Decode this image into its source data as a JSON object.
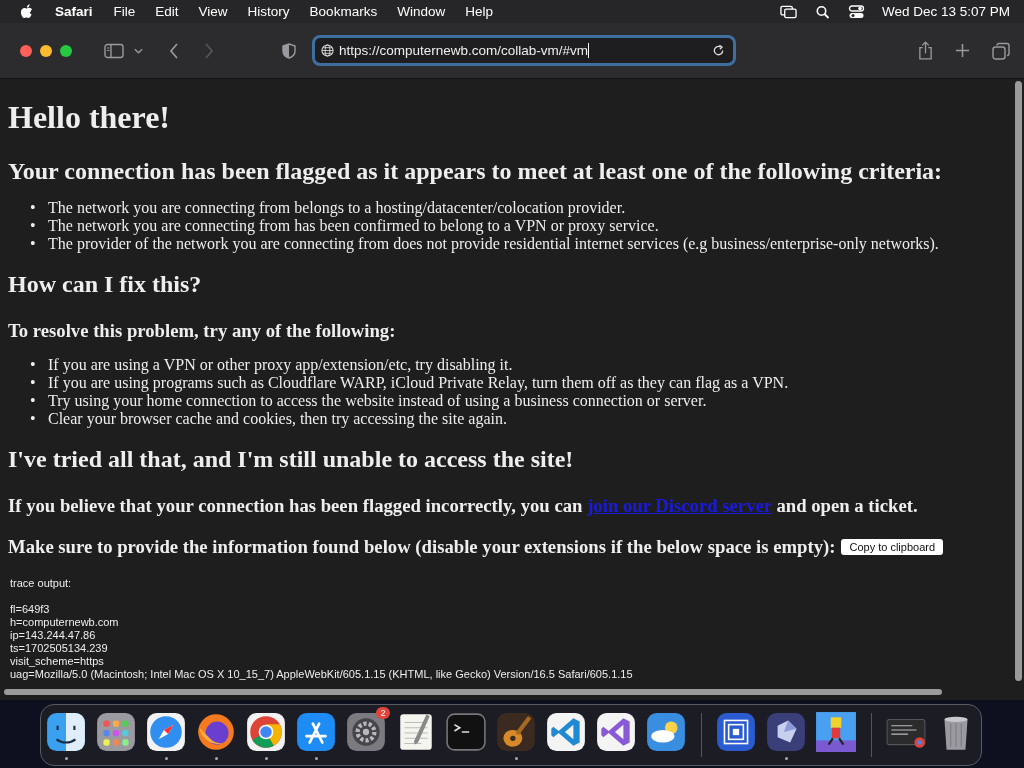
{
  "menu_bar": {
    "app": "Safari",
    "items": [
      "File",
      "Edit",
      "View",
      "History",
      "Bookmarks",
      "Window",
      "Help"
    ],
    "clock": "Wed Dec 13  5:07 PM"
  },
  "toolbar": {
    "url": "https://computernewb.com/collab-vm/#vm"
  },
  "page": {
    "title": "Hello there!",
    "bullet": "•",
    "flag_heading": "Your connection has been flagged as it appears to meet at least one of the following criteria:",
    "criteria": [
      "The network you are connecting from belongs to a hosting/datacenter/colocation provider.",
      "The network you are connecting from has been confirmed to belong to a VPN or proxy service.",
      "The provider of the network you are connecting from does not provide residential internet services (e.g business/enterprise-only networks)."
    ],
    "fix_heading": "How can I fix this?",
    "resolve_heading": "To resolve this problem, try any of the following:",
    "fixes": [
      "If you are using a VPN or other proxy app/extension/etc, try disabling it.",
      "If you are using programs such as Cloudflare WARP, iCloud Private Relay, turn them off as they can flag as a VPN.",
      "Try using your home connection to access the website instead of using a business connection or server.",
      "Clear your browser cache and cookies, then try accessing the site again."
    ],
    "tried_heading": "I've tried all that, and I'm still unable to access the site!",
    "believe_before": "If you believe that your connection has been flagged incorrectly, you can",
    "discord_link": "join our Discord server",
    "believe_after": "and open a ticket.",
    "provide_text": "Make sure to provide the information found below (disable your extensions if the below space is empty):",
    "copy_button": "Copy to clipboard",
    "trace_label": "trace output:",
    "trace_lines": [
      "fl=649f3",
      "h=computernewb.com",
      "ip=143.244.47.86",
      "ts=1702505134.239",
      "visit_scheme=https",
      "uag=Mozilla/5.0 (Macintosh; Intel Mac OS X 10_15_7) AppleWebKit/605.1.15 (KHTML, like Gecko) Version/16.5 Safari/605.1.15"
    ]
  },
  "dock": [
    {
      "kind": "finder",
      "running": true
    },
    {
      "kind": "launchpad",
      "running": false
    },
    {
      "kind": "safari",
      "running": true
    },
    {
      "kind": "firefox",
      "running": true
    },
    {
      "kind": "chrome",
      "running": true
    },
    {
      "kind": "appstore",
      "running": true
    },
    {
      "kind": "settings",
      "running": false,
      "badge": "2"
    },
    {
      "kind": "textedit",
      "running": false
    },
    {
      "kind": "terminal",
      "running": false
    },
    {
      "kind": "garageband",
      "running": true
    },
    {
      "kind": "vscode",
      "running": false
    },
    {
      "kind": "visualstudio",
      "running": false
    },
    {
      "kind": "weather",
      "running": false
    },
    {
      "kind": "separator"
    },
    {
      "kind": "utm",
      "running": false
    },
    {
      "kind": "crystal",
      "running": true
    },
    {
      "kind": "game",
      "running": false
    },
    {
      "kind": "separator"
    },
    {
      "kind": "window-thumb",
      "running": false
    },
    {
      "kind": "trash",
      "running": false
    }
  ]
}
